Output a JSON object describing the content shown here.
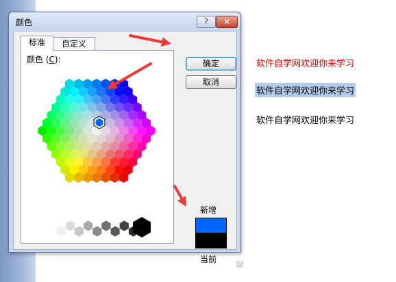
{
  "dialog": {
    "title": "颜色",
    "help_glyph": "?",
    "close_glyph": "✕",
    "tabs": [
      {
        "label": "标准",
        "active": true
      },
      {
        "label": "自定义",
        "active": false
      }
    ],
    "colors_label_prefix": "颜色 (",
    "colors_label_key": "C",
    "colors_label_suffix": "):",
    "ok_label": "确定",
    "cancel_label": "取消",
    "new_label": "新增",
    "current_label": "当前",
    "new_color": "#0066ff",
    "current_color": "#000000",
    "selected_color": "#0066ff"
  },
  "samples": [
    {
      "text": "软件自学网欢迎你来学习",
      "color": "#cc0000",
      "highlight": ""
    },
    {
      "text": "软件自学网欢迎你来学习",
      "color": "#000000",
      "highlight": "#b4ccec"
    },
    {
      "text": "软件自学网欢迎你来学习",
      "color": "#000000",
      "highlight": ""
    }
  ],
  "annotation_color": "#ee3a3a"
}
